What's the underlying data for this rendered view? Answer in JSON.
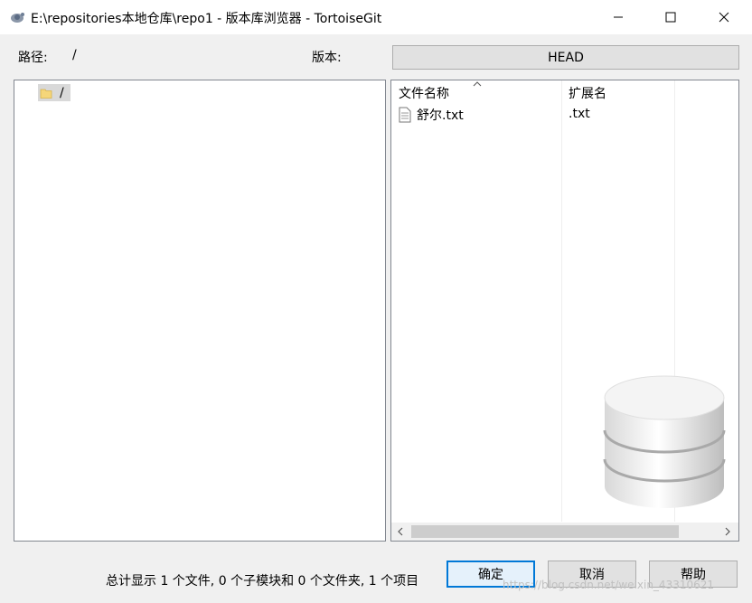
{
  "window": {
    "title": "E:\\repositories本地仓库\\repo1 - 版本库浏览器 - TortoiseGit",
    "icons": [
      "tortoise-app-icon",
      "minimize-icon",
      "maximize-icon",
      "close-icon"
    ]
  },
  "path": {
    "label": "路径:",
    "value": "/"
  },
  "revision": {
    "label": "版本:",
    "value": "HEAD"
  },
  "tree": {
    "nodes": [
      {
        "label": "/",
        "icon": "folder-icon",
        "selected": true
      }
    ]
  },
  "file_list": {
    "columns": [
      {
        "label": "文件名称",
        "sorted": true
      },
      {
        "label": "扩展名"
      }
    ],
    "rows": [
      {
        "name": "舒尔.txt",
        "extension": ".txt",
        "icon": "text-file-icon"
      }
    ]
  },
  "status": {
    "summary": "总计显示 1 个文件, 0 个子模块和 0 个文件夹, 1 个项目"
  },
  "buttons": {
    "ok": "确定",
    "cancel": "取消",
    "help": "帮助"
  },
  "watermark": "https://blog.csdn.net/weixin_43310621",
  "colors": {
    "accent": "#0078d7",
    "button_bg": "#e1e1e1",
    "window_bg": "#f0f0f0"
  }
}
